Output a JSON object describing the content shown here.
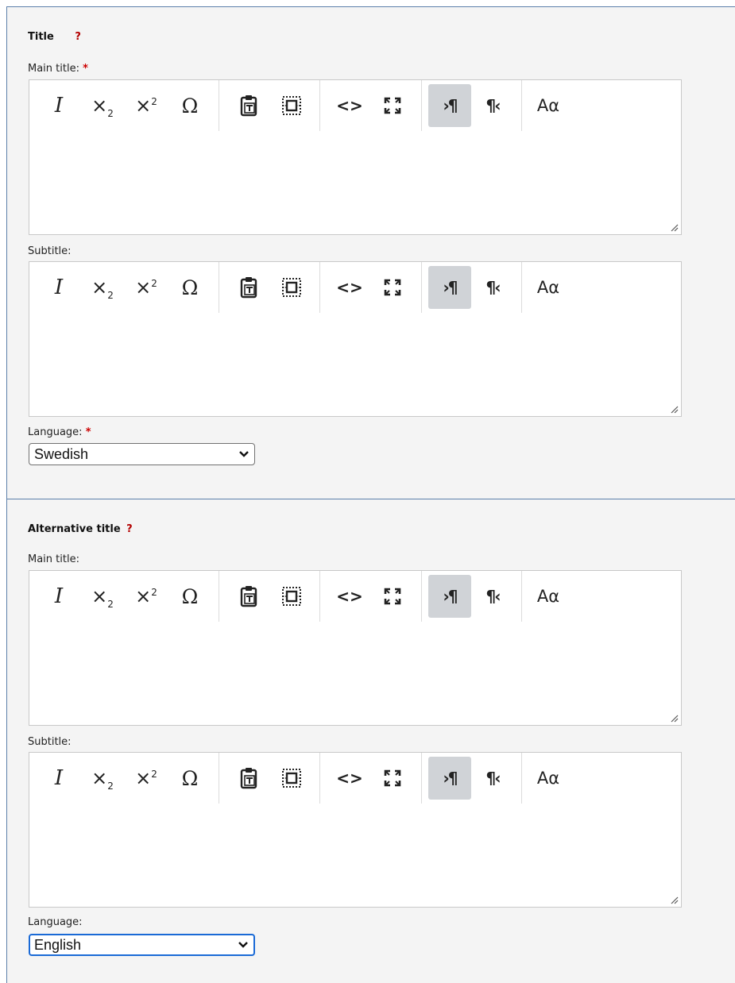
{
  "toolbar_icons": {
    "italic": "italic-icon",
    "subscript": "subscript-icon",
    "superscript": "superscript-icon",
    "special_char": "omega-icon",
    "paste_text": "paste-as-text-icon",
    "show_blocks": "show-blocks-icon",
    "source": "source-code-icon",
    "maximize": "maximize-icon",
    "ltr": "text-direction-ltr-icon",
    "rtl": "text-direction-rtl-icon",
    "styles": "styles-icon"
  },
  "toolbar_glyphs": {
    "italic": "I",
    "omega": "Ω",
    "source": "<>",
    "ltr": "›¶",
    "rtl": "¶‹",
    "styles": "Aα"
  },
  "colors": {
    "panel_bg": "#f4f4f4",
    "panel_border": "#5b7faa",
    "help_mark": "#b30000",
    "required_mark": "#cc0000",
    "active_button_bg": "#d0d3d7",
    "focus_ring": "#1a6ad6"
  },
  "title_section": {
    "heading": "Title",
    "help": "?",
    "main_title_label": "Main title:",
    "main_title_required": "*",
    "subtitle_label": "Subtitle:",
    "language_label": "Language:",
    "language_required": "*",
    "language_value": "Swedish"
  },
  "alt_title_section": {
    "heading": "Alternative title",
    "help": "?",
    "main_title_label": "Main title:",
    "subtitle_label": "Subtitle:",
    "language_label": "Language:",
    "language_value": "English"
  }
}
